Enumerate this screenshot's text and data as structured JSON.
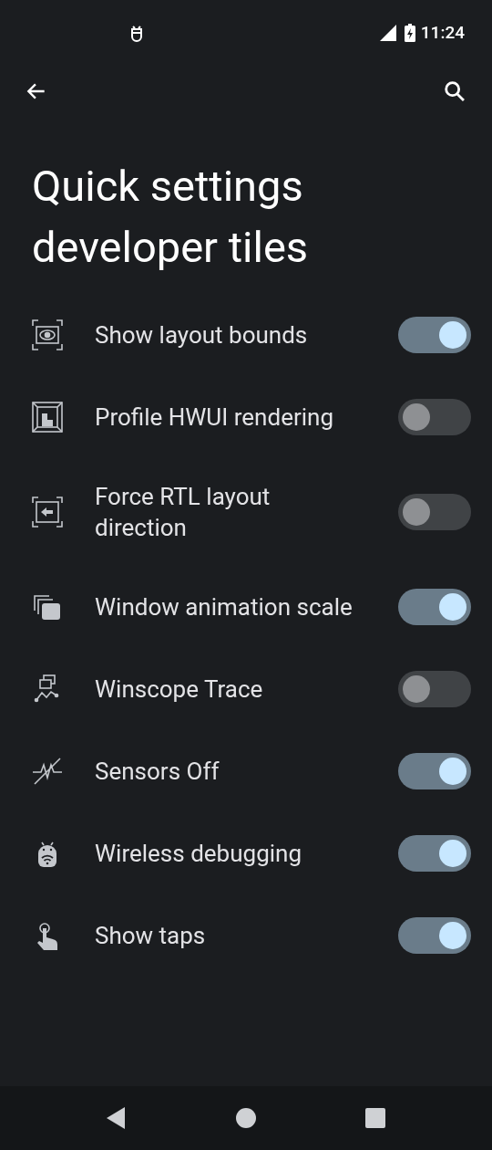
{
  "status_bar": {
    "time": "11:24"
  },
  "title": "Quick settings developer tiles",
  "tiles": [
    {
      "label": "Show layout bounds",
      "on": true
    },
    {
      "label": "Profile HWUI rendering",
      "on": false
    },
    {
      "label": "Force RTL layout direction",
      "on": false
    },
    {
      "label": "Window animation scale",
      "on": true
    },
    {
      "label": "Winscope Trace",
      "on": false
    },
    {
      "label": "Sensors Off",
      "on": true
    },
    {
      "label": "Wireless debugging",
      "on": true
    },
    {
      "label": "Show taps",
      "on": true
    }
  ]
}
